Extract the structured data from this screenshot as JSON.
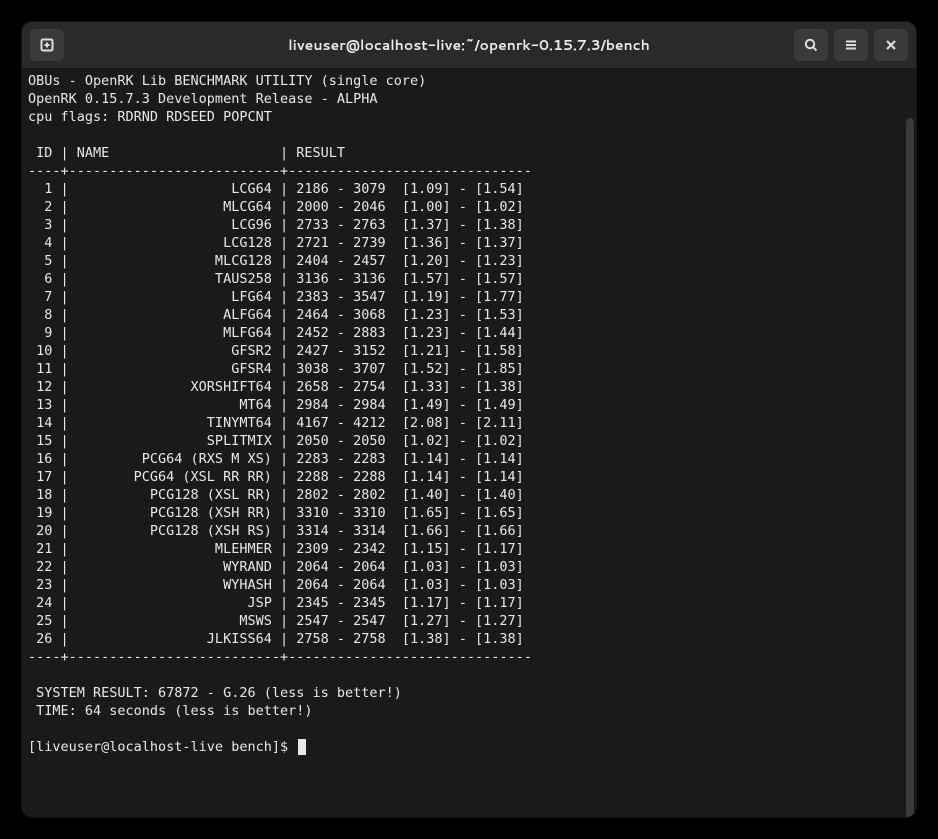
{
  "window": {
    "title": "liveuser@localhost-live:~/openrk-0.15.7.3/bench"
  },
  "terminal": {
    "header_line1": "OBUs - OpenRK Lib BENCHMARK UTILITY (single core)",
    "header_line2": "OpenRK 0.15.7.3 Development Release - ALPHA",
    "header_line3": "cpu flags: RDRND RDSEED POPCNT",
    "table_header": " ID | NAME                     | RESULT",
    "separator": "----+--------------------------+------------------------------",
    "rows": [
      {
        "id": "1",
        "name": "LCG64",
        "result": "2186 - 3079  [1.09] - [1.54]"
      },
      {
        "id": "2",
        "name": "MLCG64",
        "result": "2000 - 2046  [1.00] - [1.02]"
      },
      {
        "id": "3",
        "name": "LCG96",
        "result": "2733 - 2763  [1.37] - [1.38]"
      },
      {
        "id": "4",
        "name": "LCG128",
        "result": "2721 - 2739  [1.36] - [1.37]"
      },
      {
        "id": "5",
        "name": "MLCG128",
        "result": "2404 - 2457  [1.20] - [1.23]"
      },
      {
        "id": "6",
        "name": "TAUS258",
        "result": "3136 - 3136  [1.57] - [1.57]"
      },
      {
        "id": "7",
        "name": "LFG64",
        "result": "2383 - 3547  [1.19] - [1.77]"
      },
      {
        "id": "8",
        "name": "ALFG64",
        "result": "2464 - 3068  [1.23] - [1.53]"
      },
      {
        "id": "9",
        "name": "MLFG64",
        "result": "2452 - 2883  [1.23] - [1.44]"
      },
      {
        "id": "10",
        "name": "GFSR2",
        "result": "2427 - 3152  [1.21] - [1.58]"
      },
      {
        "id": "11",
        "name": "GFSR4",
        "result": "3038 - 3707  [1.52] - [1.85]"
      },
      {
        "id": "12",
        "name": "XORSHIFT64",
        "result": "2658 - 2754  [1.33] - [1.38]"
      },
      {
        "id": "13",
        "name": "MT64",
        "result": "2984 - 2984  [1.49] - [1.49]"
      },
      {
        "id": "14",
        "name": "TINYMT64",
        "result": "4167 - 4212  [2.08] - [2.11]"
      },
      {
        "id": "15",
        "name": "SPLITMIX",
        "result": "2050 - 2050  [1.02] - [1.02]"
      },
      {
        "id": "16",
        "name": "PCG64 (RXS M XS)",
        "result": "2283 - 2283  [1.14] - [1.14]"
      },
      {
        "id": "17",
        "name": "PCG64 (XSL RR RR)",
        "result": "2288 - 2288  [1.14] - [1.14]"
      },
      {
        "id": "18",
        "name": "PCG128 (XSL RR)",
        "result": "2802 - 2802  [1.40] - [1.40]"
      },
      {
        "id": "19",
        "name": "PCG128 (XSH RR)",
        "result": "3310 - 3310  [1.65] - [1.65]"
      },
      {
        "id": "20",
        "name": "PCG128 (XSH RS)",
        "result": "3314 - 3314  [1.66] - [1.66]"
      },
      {
        "id": "21",
        "name": "MLEHMER",
        "result": "2309 - 2342  [1.15] - [1.17]"
      },
      {
        "id": "22",
        "name": "WYRAND",
        "result": "2064 - 2064  [1.03] - [1.03]"
      },
      {
        "id": "23",
        "name": "WYHASH",
        "result": "2064 - 2064  [1.03] - [1.03]"
      },
      {
        "id": "24",
        "name": "JSP",
        "result": "2345 - 2345  [1.17] - [1.17]"
      },
      {
        "id": "25",
        "name": "MSWS",
        "result": "2547 - 2547  [1.27] - [1.27]"
      },
      {
        "id": "26",
        "name": "JLKISS64",
        "result": "2758 - 2758  [1.38] - [1.38]"
      }
    ],
    "system_result": " SYSTEM RESULT: 67872 - G.26 (less is better!)",
    "time_result": " TIME: 64 seconds (less is better!)",
    "prompt": "[liveuser@localhost-live bench]$ "
  }
}
